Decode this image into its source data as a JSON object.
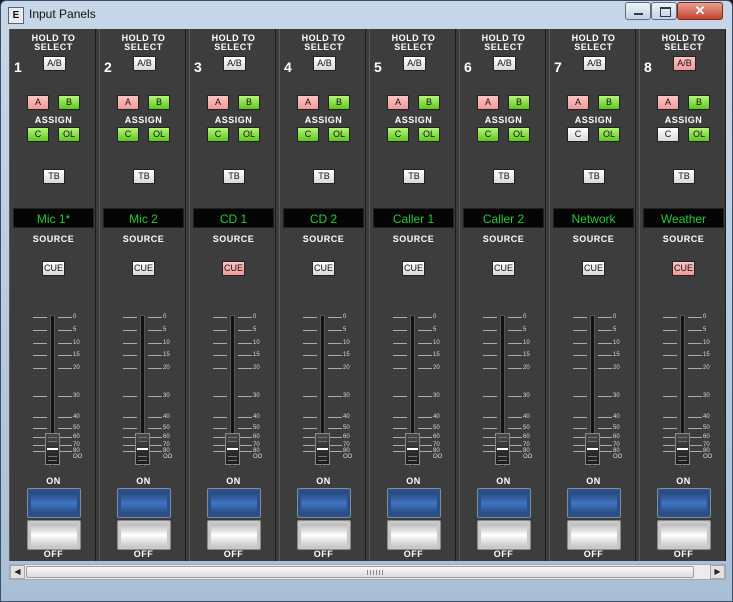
{
  "window": {
    "title": "Input Panels",
    "icon": "E"
  },
  "window_controls": {
    "minimize": "",
    "maximize": "",
    "close": "✕"
  },
  "labels": {
    "hold_to_select_1": "HOLD TO",
    "hold_to_select_2": "SELECT",
    "assign": "ASSIGN",
    "source": "SOURCE",
    "on": "ON",
    "off": "OFF"
  },
  "fader_scale": [
    "0",
    "5",
    "10",
    "15",
    "20",
    "30",
    "40",
    "50",
    "60",
    "70",
    "80"
  ],
  "fader_scale_tail": "OO",
  "colors": {
    "source_text": "#22c93a",
    "pink": "#f19a9a",
    "green": "#5ec71e",
    "white": "#ffffff"
  },
  "channels": [
    {
      "number": "1",
      "ab": "A/B",
      "ab_state": "white",
      "a": "A",
      "a_state": "pink",
      "b": "B",
      "b_state": "green",
      "c": "C",
      "c_state": "green",
      "ol": "OL",
      "ol_state": "green",
      "tb": "TB",
      "source": "Mic 1*",
      "cue": "CUE",
      "cue_state": "white"
    },
    {
      "number": "2",
      "ab": "A/B",
      "ab_state": "white",
      "a": "A",
      "a_state": "pink",
      "b": "B",
      "b_state": "green",
      "c": "C",
      "c_state": "green",
      "ol": "OL",
      "ol_state": "green",
      "tb": "TB",
      "source": "Mic 2",
      "cue": "CUE",
      "cue_state": "white"
    },
    {
      "number": "3",
      "ab": "A/B",
      "ab_state": "white",
      "a": "A",
      "a_state": "pink",
      "b": "B",
      "b_state": "green",
      "c": "C",
      "c_state": "green",
      "ol": "OL",
      "ol_state": "green",
      "tb": "TB",
      "source": "CD 1",
      "cue": "CUE",
      "cue_state": "pink"
    },
    {
      "number": "4",
      "ab": "A/B",
      "ab_state": "white",
      "a": "A",
      "a_state": "pink",
      "b": "B",
      "b_state": "green",
      "c": "C",
      "c_state": "green",
      "ol": "OL",
      "ol_state": "green",
      "tb": "TB",
      "source": "CD 2",
      "cue": "CUE",
      "cue_state": "white"
    },
    {
      "number": "5",
      "ab": "A/B",
      "ab_state": "white",
      "a": "A",
      "a_state": "pink",
      "b": "B",
      "b_state": "green",
      "c": "C",
      "c_state": "green",
      "ol": "OL",
      "ol_state": "green",
      "tb": "TB",
      "source": "Caller 1",
      "cue": "CUE",
      "cue_state": "white"
    },
    {
      "number": "6",
      "ab": "A/B",
      "ab_state": "white",
      "a": "A",
      "a_state": "pink",
      "b": "B",
      "b_state": "green",
      "c": "C",
      "c_state": "green",
      "ol": "OL",
      "ol_state": "green",
      "tb": "TB",
      "source": "Caller 2",
      "cue": "CUE",
      "cue_state": "white"
    },
    {
      "number": "7",
      "ab": "A/B",
      "ab_state": "white",
      "a": "A",
      "a_state": "pink",
      "b": "B",
      "b_state": "green",
      "c": "C",
      "c_state": "white",
      "ol": "OL",
      "ol_state": "green",
      "tb": "TB",
      "source": "Network",
      "cue": "CUE",
      "cue_state": "white"
    },
    {
      "number": "8",
      "ab": "A/B",
      "ab_state": "pink",
      "a": "A",
      "a_state": "pink",
      "b": "B",
      "b_state": "green",
      "c": "C",
      "c_state": "white",
      "ol": "OL",
      "ol_state": "green",
      "tb": "TB",
      "source": "Weather",
      "cue": "CUE",
      "cue_state": "pink"
    }
  ],
  "scrollbar": {
    "left_arrow": "◀",
    "right_arrow": "▶"
  }
}
